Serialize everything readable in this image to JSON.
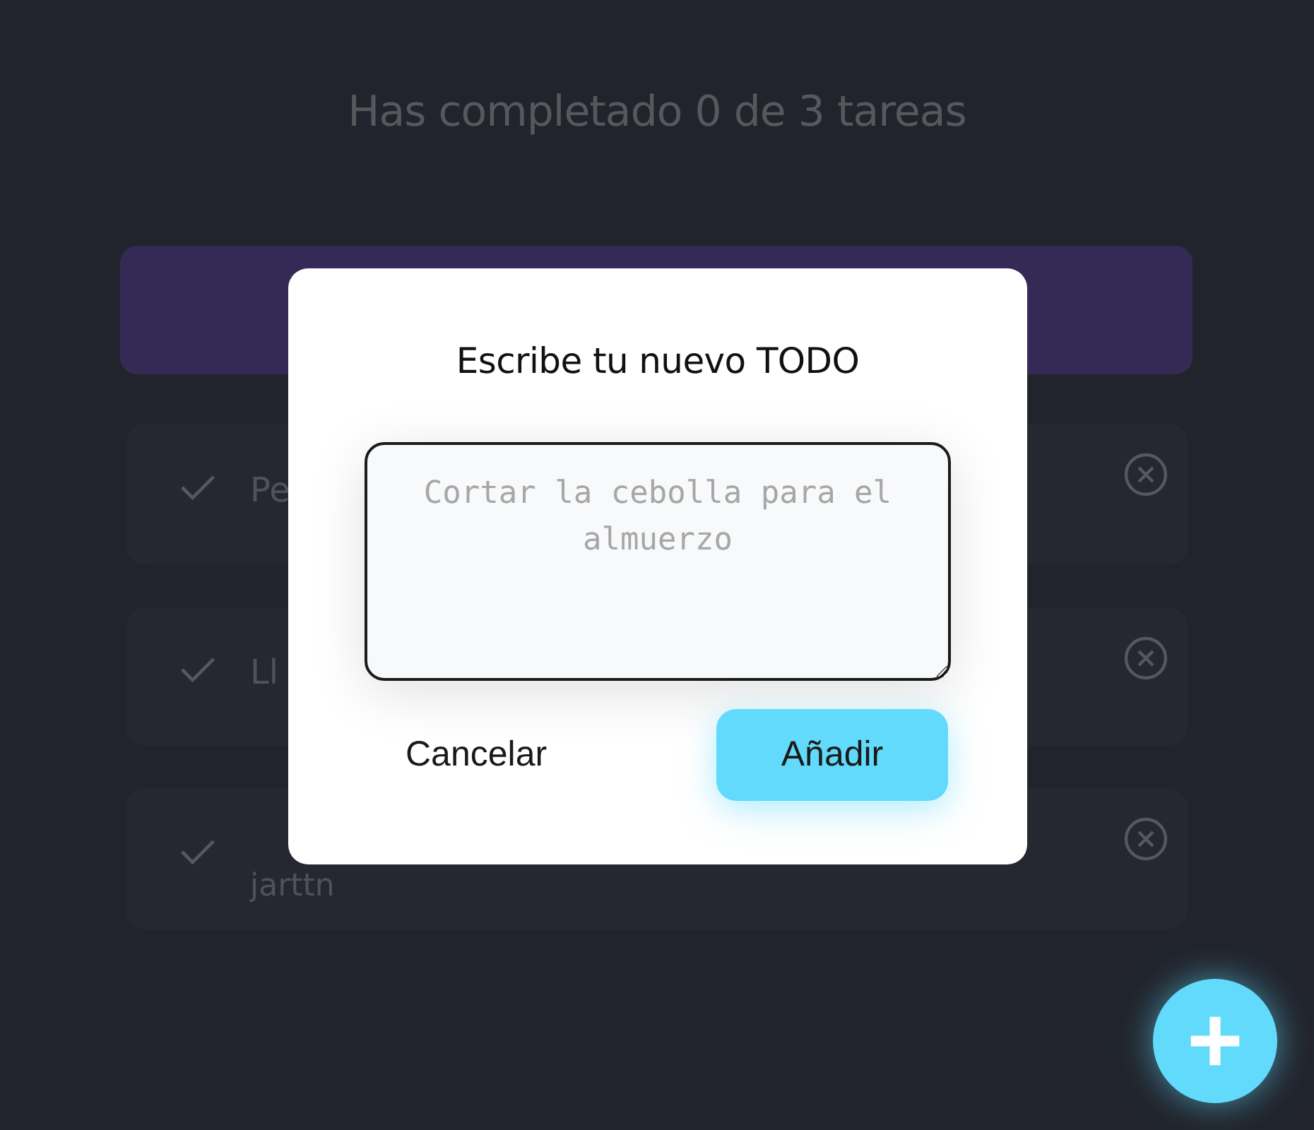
{
  "counter": {
    "text": "Has completado 0 de 3 tareas"
  },
  "todos": [
    {
      "text": "Pe",
      "completed": false
    },
    {
      "text": "Ll",
      "completed": false
    },
    {
      "text": "jarttn",
      "completed": false
    }
  ],
  "modal": {
    "title": "Escribe tu nuevo TODO",
    "placeholder": "Cortar la cebolla para el almuerzo",
    "cancel": "Cancelar",
    "submit": "Añadir"
  }
}
